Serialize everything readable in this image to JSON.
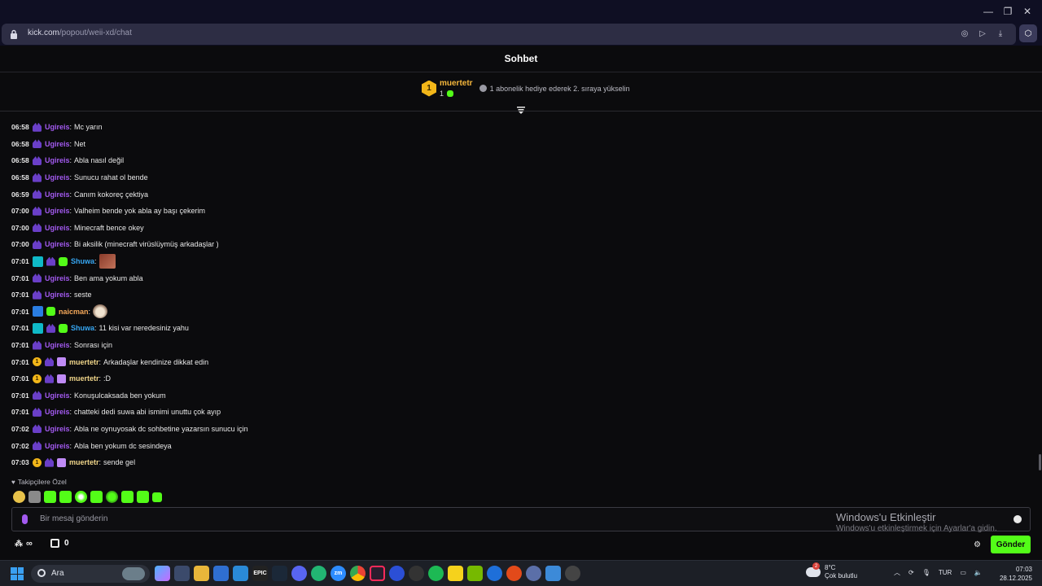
{
  "browser": {
    "url_host": "kick.com",
    "url_path": "/popout/weii-xd/chat"
  },
  "chat": {
    "title": "Sohbet",
    "pinned": {
      "rank": "1",
      "username": "muertetr",
      "count": "1",
      "message": "1 abonelik hediye ederek 2. sıraya yükselin"
    },
    "messages": [
      {
        "time": "06:58",
        "user": "Ugireis",
        "text": "Mc yarın"
      },
      {
        "time": "06:58",
        "user": "Ugireis",
        "text": "Net"
      },
      {
        "time": "06:58",
        "user": "Ugireis",
        "text": "Abla nasıl değil"
      },
      {
        "time": "06:58",
        "user": "Ugireis",
        "text": "Sunucu rahat ol bende"
      },
      {
        "time": "06:59",
        "user": "Ugireis",
        "text": "Canım kokoreç çektiya"
      },
      {
        "time": "07:00",
        "user": "Ugireis",
        "text": "Valheim bende yok abla ay başı çekerim"
      },
      {
        "time": "07:00",
        "user": "Ugireis",
        "text": "Minecraft bence okey"
      },
      {
        "time": "07:00",
        "user": "Ugireis",
        "text": "Bi aksilik (minecraft virüslüymüş arkadaşlar )"
      },
      {
        "time": "07:01",
        "user": "Shuwa",
        "text": ""
      },
      {
        "time": "07:01",
        "user": "Ugireis",
        "text": "Ben ama yokum abla"
      },
      {
        "time": "07:01",
        "user": "Ugireis",
        "text": "seste"
      },
      {
        "time": "07:01",
        "user": "naicman",
        "text": ""
      },
      {
        "time": "07:01",
        "user": "Shuwa",
        "text": "11 kisi var neredesiniz yahu"
      },
      {
        "time": "07:01",
        "user": "Ugireis",
        "text": "Sonrası için"
      },
      {
        "time": "07:01",
        "user": "muertetr",
        "text": "Arkadaşlar kendinize dikkat edin"
      },
      {
        "time": "07:01",
        "user": "muertetr",
        "text": ":D"
      },
      {
        "time": "07:01",
        "user": "Ugireis",
        "text": "Konuşulcaksada ben yokum"
      },
      {
        "time": "07:01",
        "user": "Ugireis",
        "text": "chatteki dedi suwa abi ismimi unuttu çok ayıp"
      },
      {
        "time": "07:02",
        "user": "Ugireis",
        "text": "Abla ne oynuyosak dc sohbetine yazarsın sunucu için"
      },
      {
        "time": "07:02",
        "user": "Ugireis",
        "text": "Abla ben yokum dc sesindeya"
      },
      {
        "time": "07:03",
        "user": "muertetr",
        "text": "sende gel"
      }
    ],
    "followers_only": "Takipçilere Özel",
    "input_placeholder": "Bir mesaj gönderin",
    "watermark_title": "Windows'u Etkinleştir",
    "watermark_sub": "Windows'u etkinleştirmek için Ayarlar'a gidin.",
    "infinity": "∞",
    "store_count": "0",
    "send_label": "Gönder"
  },
  "taskbar": {
    "search_label": "Ara",
    "weather_temp": "8°C",
    "weather_desc": "Çok bulutlu",
    "weather_badge": "2",
    "lang": "TUR",
    "time": "07:03",
    "date": "28.12.2025"
  }
}
